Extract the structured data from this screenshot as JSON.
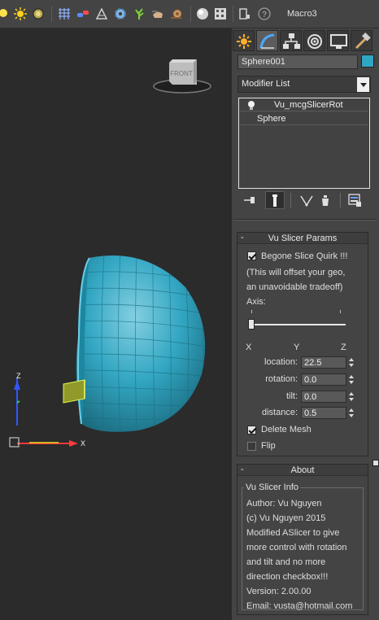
{
  "toolbar": {
    "icons": [
      "helper-bulb-icon",
      "sun-light-icon",
      "material-sphere-icon",
      "hatch-grid-icon",
      "link-chain-icon",
      "bone-icon",
      "gear-icon",
      "plant-icon",
      "hand-icon",
      "snail-icon",
      "shaded-sphere-icon",
      "render-grid-icon",
      "layer-stack-icon",
      "help-icon"
    ],
    "macro_label": "Macro3"
  },
  "viewport": {
    "viewcube_label": "FRONT",
    "axis_labels": {
      "z": "Z",
      "x": "X"
    },
    "colors": {
      "sphere": "#2fa6c2",
      "slicer": "#b8c044",
      "axis_x": "#ff3b3b",
      "axis_z": "#3355ff",
      "axis_y": "#33cc33"
    }
  },
  "command_panel": {
    "tabs": [
      "create-icon",
      "modify-icon",
      "hierarchy-icon",
      "motion-icon",
      "display-icon",
      "utilities-icon"
    ],
    "active_tab": "modify-icon",
    "object_name": "Sphere001",
    "object_color": "#2fa6c2",
    "modifier_list_label": "Modifier List",
    "stack": [
      {
        "label": "Vu_mcgSlicerRot",
        "icon": "lightbulb-icon"
      },
      {
        "label": "Sphere",
        "icon": ""
      }
    ],
    "stack_buttons": [
      "pin-stack-icon",
      "show-end-result-icon",
      "make-unique-icon",
      "remove-modifier-icon",
      "configure-modifier-sets-icon"
    ]
  },
  "vu_slicer_params": {
    "title": "Vu Slicer Params",
    "begone_label": "Begone Slice Quirk !!!",
    "begone_checked": true,
    "note_line1": "(This will offset your geo,",
    "note_line2": "an unavoidable tradeoff)",
    "axis_label": "Axis:",
    "axis_slider_value": 0,
    "axis_ticks": {
      "x": "X",
      "y": "Y",
      "z": "Z"
    },
    "location_label": "location:",
    "location_value": "22.5",
    "rotation_label": "rotation:",
    "rotation_value": "0.0",
    "tilt_label": "tilt:",
    "tilt_value": "0.0",
    "distance_label": "distance:",
    "distance_value": "0.5",
    "delete_mesh_label": "Delete Mesh",
    "delete_mesh_checked": true,
    "flip_label": "Flip",
    "flip_checked": false
  },
  "about": {
    "title": "About",
    "group_title": "Vu Slicer Info",
    "lines": [
      "Author: Vu Nguyen",
      "(c) Vu Nguyen 2015",
      "Modified ASlicer to give",
      "more control with rotation",
      "and tilt and no more",
      "direction checkbox!!!",
      "Version: 2.00.00",
      "Email: vusta@hotmail.com"
    ]
  }
}
